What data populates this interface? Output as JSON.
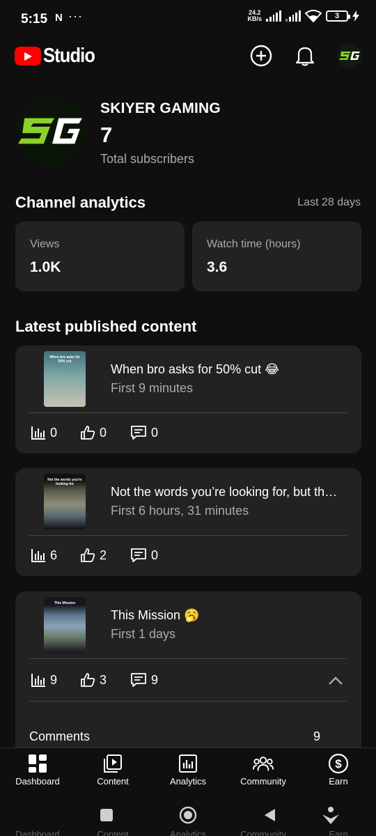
{
  "status_bar": {
    "time": "5:15",
    "net_speed": "24.2",
    "net_unit": "KB/s",
    "battery": "3"
  },
  "header": {
    "app_name": "Studio"
  },
  "channel": {
    "name": "SKIYER GAMING",
    "subscribers": "7",
    "subscribers_label": "Total subscribers"
  },
  "analytics": {
    "title": "Channel analytics",
    "period": "Last 28 days",
    "cards": [
      {
        "label": "Views",
        "value": "1.0K"
      },
      {
        "label": "Watch time (hours)",
        "value": "3.6"
      }
    ]
  },
  "latest": {
    "title": "Latest published content",
    "videos": [
      {
        "title": "When bro asks for 50% cut 😂",
        "time": "First 9 minutes",
        "views": "0",
        "likes": "0",
        "comments": "0",
        "thumb_caption": "When bro asks for 50% cut"
      },
      {
        "title": "Not the words you’re looking for, but th…",
        "time": "First 6 hours, 31 minutes",
        "views": "6",
        "likes": "2",
        "comments": "0",
        "thumb_caption": "Not the words you're looking for"
      },
      {
        "title": "This Mission 🥱",
        "time": "First 1 days",
        "views": "9",
        "likes": "3",
        "comments": "9",
        "thumb_caption": "This Mission",
        "comments_label": "Comments",
        "comments_count": "9"
      }
    ]
  },
  "bottom_nav": [
    {
      "label": "Dashboard",
      "icon": "dashboard-icon"
    },
    {
      "label": "Content",
      "icon": "content-icon"
    },
    {
      "label": "Analytics",
      "icon": "analytics-icon"
    },
    {
      "label": "Community",
      "icon": "community-icon"
    },
    {
      "label": "Earn",
      "icon": "earn-icon"
    }
  ],
  "colors": {
    "background": "#0f0f0f",
    "card": "#222222",
    "muted_text": "#aaaaaa",
    "brand_red": "#ff0000",
    "avatar_green": "#7ed321"
  }
}
